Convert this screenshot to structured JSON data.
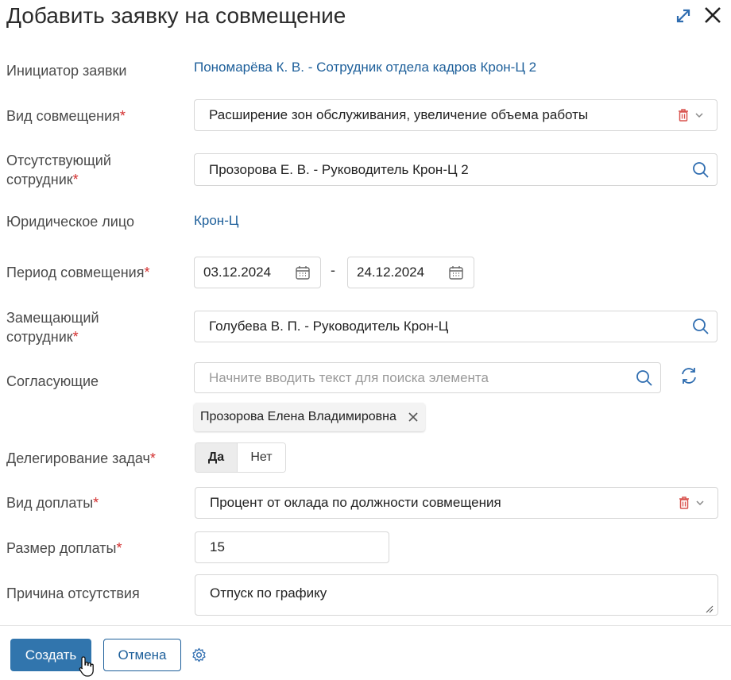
{
  "header": {
    "title": "Добавить заявку на совмещение"
  },
  "form": {
    "initiator": {
      "label": "Инициатор заявки",
      "value": "Пономарёва К. В. - Сотрудник отдела кадров Крон-Ц 2"
    },
    "combination_type": {
      "label": "Вид совмещения",
      "value": "Расширение зон обслуживания, увеличение объема работы"
    },
    "absent_employee": {
      "label_line1": "Отсутствующий",
      "label_line2": "сотрудник",
      "value": "Прозорова Е. В. - Руководитель Крон-Ц 2"
    },
    "legal_entity": {
      "label": "Юридическое лицо",
      "value": "Крон-Ц"
    },
    "period": {
      "label": "Период совмещения",
      "start": "03.12.2024",
      "separator": "-",
      "end": "24.12.2024"
    },
    "replacing_employee": {
      "label_line1": "Замещающий",
      "label_line2": "сотрудник",
      "value": "Голубева В. П. - Руководитель Крон-Ц"
    },
    "approvers": {
      "label": "Согласующие",
      "placeholder": "Начните вводить текст для поиска элемента",
      "chips": [
        "Прозорова Елена Владимировна"
      ]
    },
    "task_delegation": {
      "label": "Делегирование задач",
      "options": [
        "Да",
        "Нет"
      ],
      "selected": "Да"
    },
    "surcharge_type": {
      "label": "Вид доплаты",
      "value": "Процент от оклада по должности совмещения"
    },
    "surcharge_amount": {
      "label": "Размер доплаты",
      "value": "15"
    },
    "absence_reason": {
      "label": "Причина отсутствия",
      "value": "Отпуск по графику"
    },
    "required_mark": "*"
  },
  "footer": {
    "create_label": "Создать",
    "cancel_label": "Отмена"
  },
  "colors": {
    "primary": "#3175ad",
    "link": "#1d5f9a",
    "required": "#d32f2f",
    "delete": "#d9534f"
  },
  "icons": [
    "expand-icon",
    "close-icon",
    "trash-icon",
    "chevron-down-icon",
    "search-icon",
    "calendar-icon",
    "refresh-icon",
    "gear-icon",
    "cursor-hand-icon"
  ]
}
